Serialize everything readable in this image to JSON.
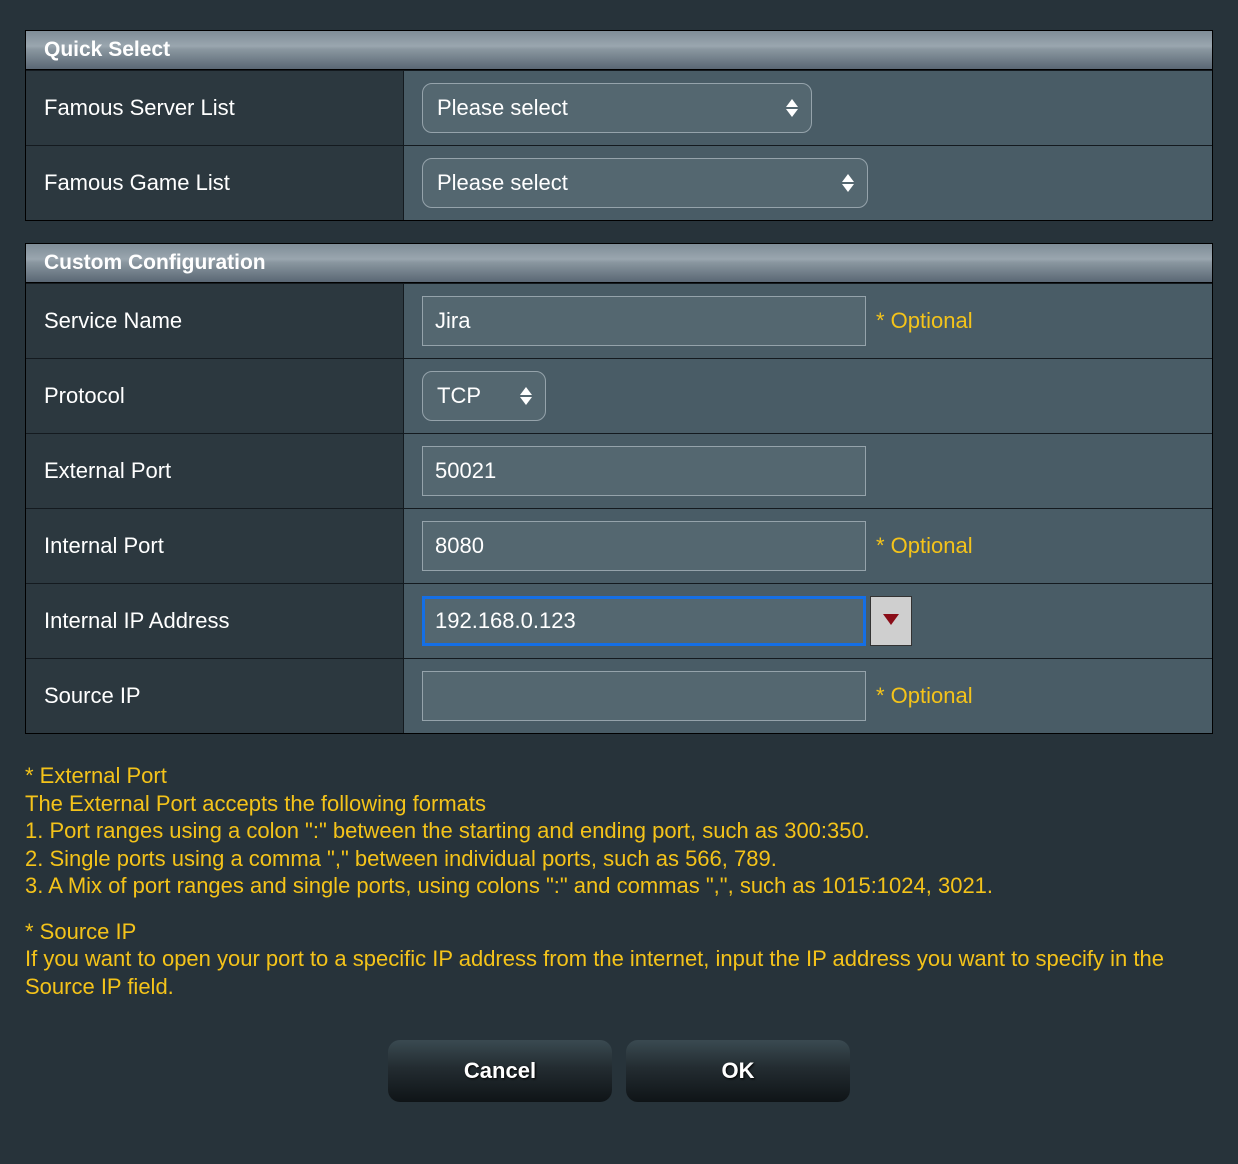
{
  "quick_select": {
    "title": "Quick Select",
    "server_list_label": "Famous Server List",
    "server_list_value": "Please select",
    "game_list_label": "Famous Game List",
    "game_list_value": "Please select"
  },
  "custom": {
    "title": "Custom Configuration",
    "service_name_label": "Service Name",
    "service_name_value": "Jira",
    "protocol_label": "Protocol",
    "protocol_value": "TCP",
    "ext_port_label": "External Port",
    "ext_port_value": "50021",
    "int_port_label": "Internal Port",
    "int_port_value": "8080",
    "int_ip_label": "Internal IP Address",
    "int_ip_value": "192.168.0.123",
    "src_ip_label": "Source IP",
    "src_ip_value": "",
    "optional_text": "* Optional"
  },
  "help": {
    "l1": "* External Port",
    "l2": "The External Port accepts the following formats",
    "l3": "1. Port ranges using a colon \":\" between the starting and ending port, such as 300:350.",
    "l4": "2. Single ports using a comma \",\" between individual ports, such as 566, 789.",
    "l5": "3. A Mix of port ranges and single ports, using colons \":\" and commas \",\", such as 1015:1024, 3021.",
    "l6": "* Source IP",
    "l7": "If you want to open your port to a specific IP address from the internet, input the IP address you want to specify in the Source IP field."
  },
  "buttons": {
    "cancel": "Cancel",
    "ok": "OK"
  }
}
